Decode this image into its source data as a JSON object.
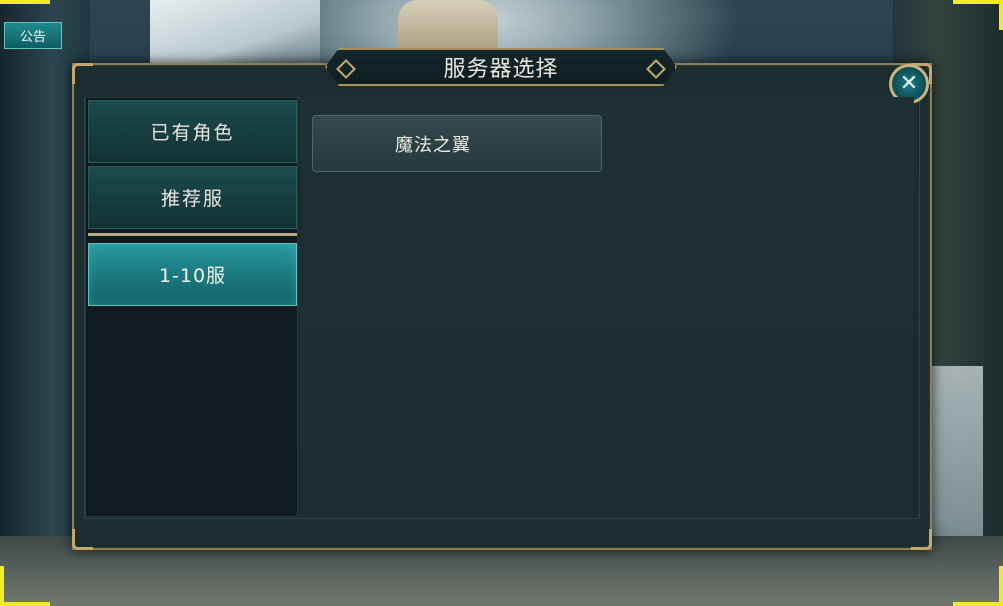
{
  "notice": {
    "label": "公告"
  },
  "dialog": {
    "title": "服务器选择",
    "close_icon": "close-icon"
  },
  "sidebar": {
    "items": [
      {
        "label": "已有角色",
        "active": false
      },
      {
        "label": "推荐服",
        "active": false
      },
      {
        "label": "1-10服",
        "active": true
      }
    ]
  },
  "servers": [
    {
      "name": "魔法之翼"
    }
  ],
  "colors": {
    "accent_gold": "#c4a76b",
    "active_tab": "#1b7d83",
    "panel_bg": "#1c2d30",
    "marker_yellow": "#f1ec1f"
  }
}
